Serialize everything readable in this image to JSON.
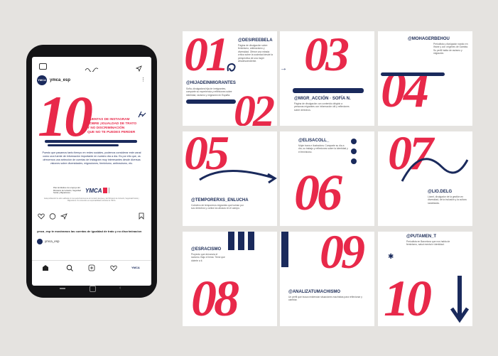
{
  "colors": {
    "red": "#e8294a",
    "navy": "#1a2a5c",
    "background": "#e5e3e0"
  },
  "phone": {
    "account": "ymca_esp",
    "avatar_label": "YMCA",
    "post": {
      "big_number": "10",
      "headline": [
        "CUENTAS DE INSTAGRAM",
        "SOBRE ¡IGUALDAD DE TRATO",
        "Y NO DISCRIMINACIÓN",
        "QUE NO TE PUEDES PERDER"
      ],
      "body": "Puesto que pasamos tanto tiempo en redes sociales, podemos considerar este canal como una fuente de información importante en nuestro día a día. Es por ello que, os ofrecemos una selección de cuentas de Instagram muy interesantes desde diversas visiones sobre diversidades, migraciones, feminismo, antirracismo, etc.",
      "footer_text": "Plan de Medios con el apoyo del Ministerio de Inclusión, Seguridad Social y Migraciones",
      "footer_logo": "YMCA",
      "footer_small": "Esta publicación ha sido realizada con la ayuda financiera de la Comisión Europea y del Ministerio de Inclusión, Seguridad Social y Migraciones. Su contenido es responsabilidad exclusiva de YMCA."
    },
    "caption": "ymca_esp te mostramos las cuentas de igualdad de trato y no discriminacion",
    "profile_handle": "ymca_esp",
    "bottom_nav_label": "YMCA"
  },
  "tiles": [
    {
      "num": "01",
      "handle": "@DESIREEBELA",
      "handle2": "@HIJADEINMIGRANTES",
      "desc": "Página de divulgación sobre feminismo, antirracismo y diversidad. Ofrece una mirada crítica sobre la sociedad desde la perspectiva de una mujer afrodescendiente.",
      "desc2": "Sofía, divulgadora hija de inmigrantes, comparte su experiencia y reflexiones sobre identidad, racismo y migración en España."
    },
    {
      "num": "02",
      "handle": "",
      "desc": ""
    },
    {
      "num": "03",
      "handle": "@MIGR_ACCIÓN · SOFÍA N.",
      "desc": "Página de divulgación con contenido dirigido a personas migrantes con información útil y reflexiones sobre derechos."
    },
    {
      "num": "04",
      "handle": "@MOHAGERBEHOU",
      "desc": "Periodista y divulgador nacido en Ifrane y con orígenes de Gambia. Su perfil habla de racismo y migración."
    },
    {
      "num": "05",
      "handle": "@TEMPORERXS_ENLUCHA",
      "desc": "Colectivo de temporeros migrantes que luchan por sus derechos y contra los abusos en el campo."
    },
    {
      "num": "06",
      "handle": "@ELISACOLL_",
      "desc": "Mujer trans e ilustradora. Comparte su día a día, su trabajo y reflexiones sobre la identidad y el feminismo."
    },
    {
      "num": "07",
      "handle": "@LIO.DELG",
      "desc": "Lionel, divulgador de la gestión en diversidad, de la inclusión y la cultura racializada."
    },
    {
      "num": "08",
      "handle": "@ESRACISMO",
      "desc": "Proyecto que denuncia el racismo. Bajo el lema: Tiene que dolerte a ti."
    },
    {
      "num": "09",
      "handle": "@ANALIZATUMACHISMO",
      "desc": "Un perfil que busca evidenciar situaciones machistas para reflexionar y cambiar."
    },
    {
      "num": "10",
      "handle": "@PUTAMEN_T",
      "desc": "Periodista en Barcelona que nos habla de feminismo, salud mental e identidad."
    }
  ]
}
